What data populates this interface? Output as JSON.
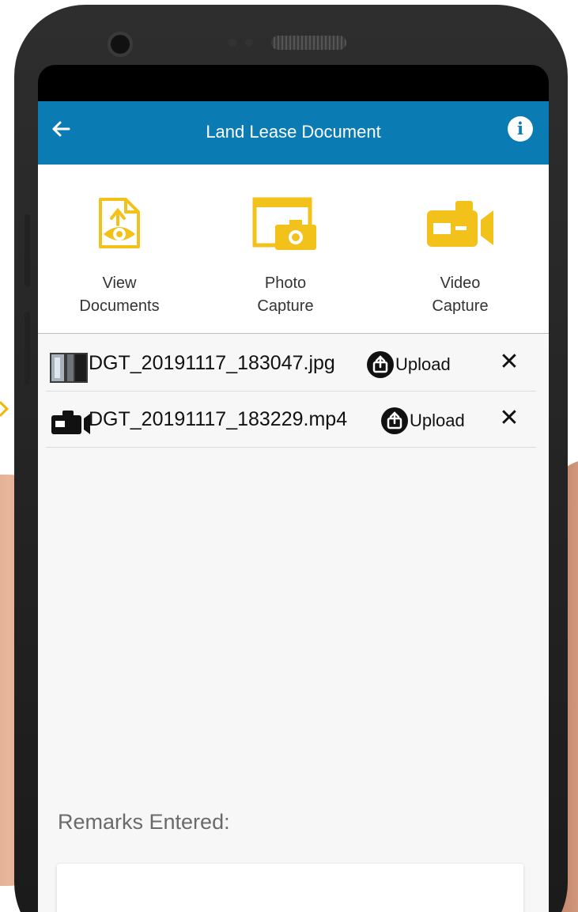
{
  "header": {
    "title": "Land Lease Document",
    "back_icon": "arrow-left-icon",
    "info_icon": "info-icon",
    "info_glyph": "i",
    "bg_color": "#0a7bb3"
  },
  "actions": [
    {
      "label": "View\nDocuments",
      "icon": "view-document-icon"
    },
    {
      "label": "Photo\nCapture",
      "icon": "photo-capture-icon"
    },
    {
      "label": "Video\nCapture",
      "icon": "video-capture-icon"
    }
  ],
  "accent_color": "#f2c21b",
  "files": [
    {
      "name": "DGT_20191117_183047.jpg",
      "type_icon": "image-thumbnail-icon",
      "upload_label": "Upload",
      "close_glyph": "✕"
    },
    {
      "name": "DGT_20191117_183229.mp4",
      "type_icon": "video-camera-icon",
      "upload_label": "Upload",
      "close_glyph": "✕"
    }
  ],
  "remarks": {
    "label": "Remarks Entered:",
    "value": ""
  }
}
